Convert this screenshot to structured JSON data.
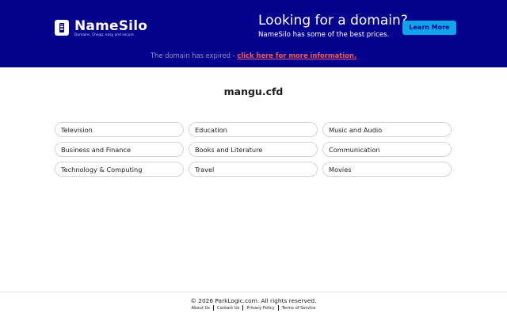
{
  "header": {
    "logo_name": "NameSilo",
    "logo_tagline": "Domains. Cheap, easy and secure",
    "promo_title": "Looking for a domain?",
    "promo_subtitle": "NameSilo has some of the best prices.",
    "learn_more_label": "Learn More",
    "colors": {
      "banner": "#04018c",
      "button": "#0ea5ea",
      "link": "#f25a5a"
    }
  },
  "notice": {
    "text": "The domain has expired - ",
    "link_text": "click here for more information."
  },
  "main": {
    "domain": "mangu.cfd",
    "categories": [
      "Television",
      "Education",
      "Music and Audio",
      "Business and Finance",
      "Books and Literature",
      "Communication",
      "Technology & Computing",
      "Travel",
      "Movies"
    ]
  },
  "footer": {
    "copyright": "© 2026 ParkLogic.com. All rights reserved.",
    "links": [
      "About Us",
      "Contact Us",
      "Privacy Policy",
      "Terms of Service"
    ]
  }
}
